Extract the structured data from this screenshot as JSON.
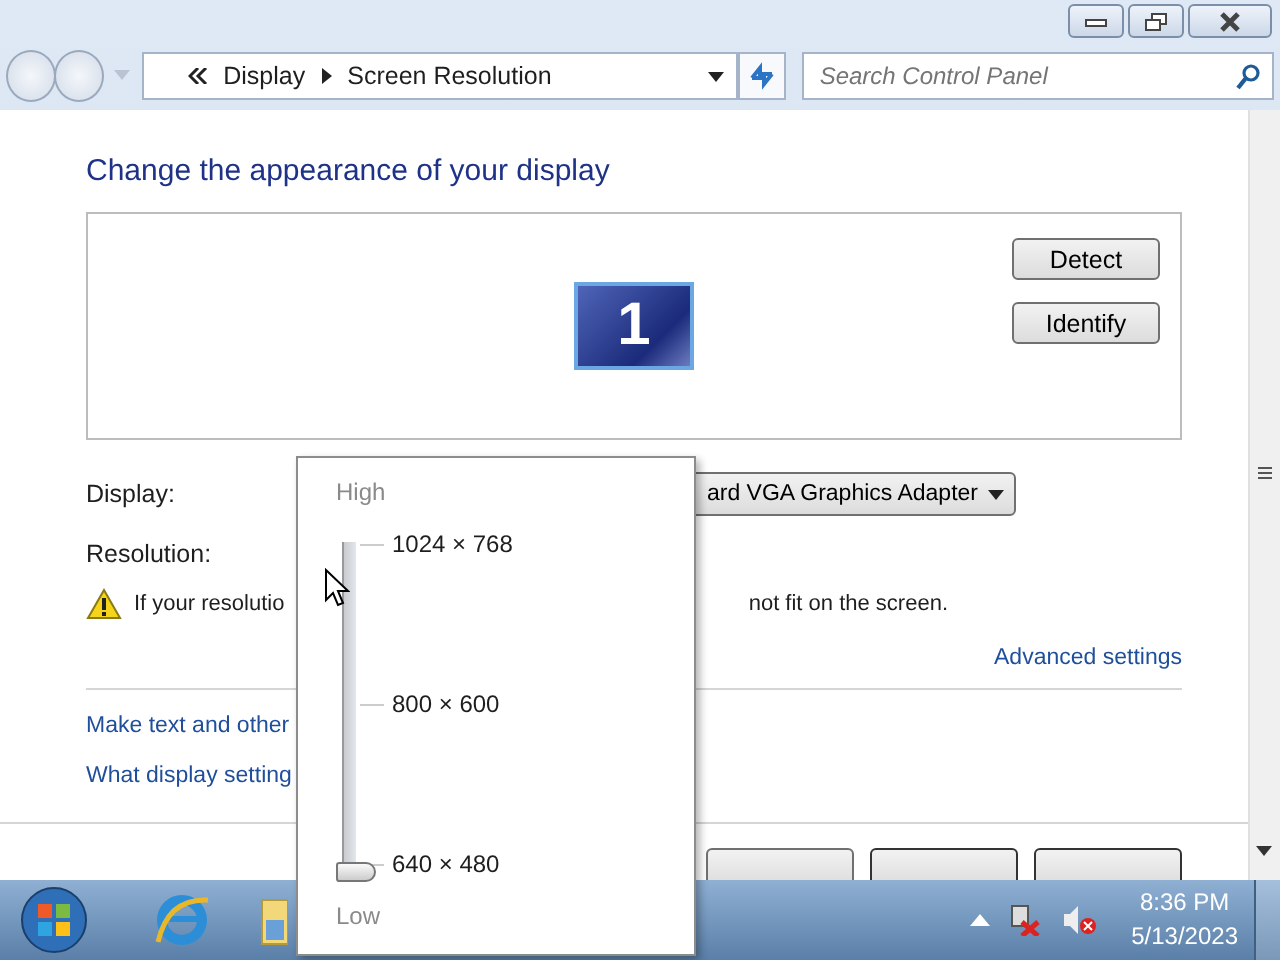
{
  "address": {
    "crumbs": [
      "Display",
      "Screen Resolution"
    ]
  },
  "search": {
    "placeholder": "Search Control Panel"
  },
  "heading": "Change the appearance of your display",
  "monitor": {
    "label": "1"
  },
  "monitor_buttons": [
    "Detect",
    "Identify"
  ],
  "display": {
    "label": "Display:",
    "value": "ard VGA Graphics Adapter"
  },
  "resolution": {
    "label": "Resolution:"
  },
  "warning": {
    "left": "If your resolutio",
    "right": "not fit on the screen."
  },
  "advanced_link": "Advanced settings",
  "links": [
    "Make text and other",
    "What display setting"
  ],
  "resolution_popup": {
    "high": "High",
    "low": "Low",
    "options": [
      "1024 × 768",
      "800 × 600",
      "640 × 480"
    ],
    "level": 0
  },
  "clock": {
    "time": "8:36 PM",
    "date": "5/13/2023"
  }
}
